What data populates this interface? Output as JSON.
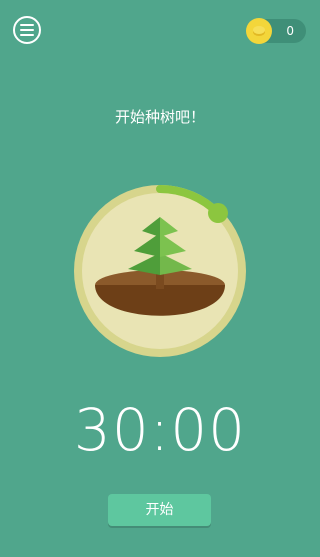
{
  "header": {
    "menu_icon": "menu-icon",
    "coin_icon": "coin-icon",
    "coin_count": "0"
  },
  "main": {
    "prompt": "开始种树吧！",
    "timer": "30:00",
    "start_label": "开始",
    "tree_icon": "tree-icon",
    "progress": 0.125
  },
  "colors": {
    "background": "#50a68c",
    "dial_ring": "#d7d58c",
    "dial_fill": "#e9e4b4",
    "progress_arc": "#8cc63f",
    "soil_top": "#8b5a2b",
    "soil_body": "#6d3f17",
    "tree_dark": "#4f9e3a",
    "tree_light": "#7cc24f",
    "button": "#5ec79f",
    "coin": "#f3d63a"
  }
}
